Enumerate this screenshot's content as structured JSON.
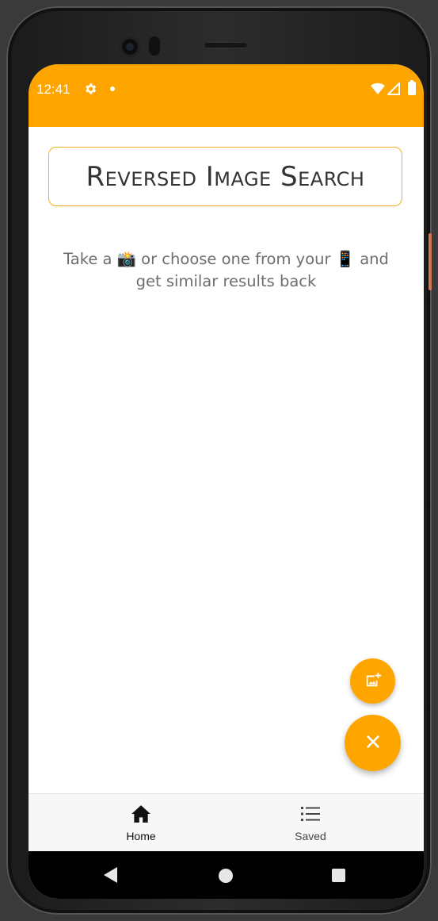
{
  "status_bar": {
    "time": "12:41",
    "background": "#ffa500",
    "icons": [
      "gear-icon",
      "notification-dot-icon",
      "wifi-icon",
      "signal-icon",
      "battery-icon"
    ]
  },
  "header": {
    "title": "Reversed Image Search",
    "border_color": "#f0b020"
  },
  "main": {
    "hint_line1": "Take a 📸 or choose one from your 📱 and",
    "hint_line2": "get similar results back"
  },
  "fabs": {
    "add_image_icon": "add-photo-icon",
    "close_icon": "close-icon",
    "color": "#ffa500"
  },
  "bottom_nav": {
    "items": [
      {
        "label": "Home",
        "icon": "home-icon",
        "active": true
      },
      {
        "label": "Saved",
        "icon": "list-icon",
        "active": false
      }
    ]
  },
  "system_nav": {
    "icons": [
      "back-icon",
      "home-circle-icon",
      "recents-icon"
    ]
  }
}
